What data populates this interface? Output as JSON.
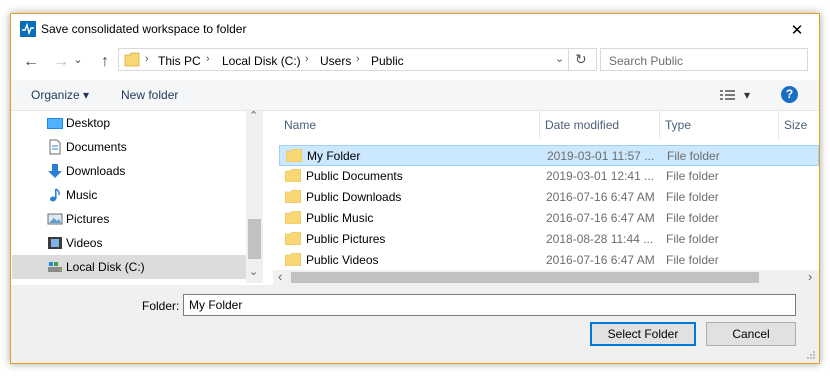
{
  "window": {
    "title": "Save consolidated workspace to folder",
    "close_glyph": "✕"
  },
  "nav_buttons": {
    "back": "←",
    "forward": "→",
    "dropdown": "⌄",
    "up": "↑"
  },
  "address": {
    "path": [
      "This PC",
      "Local Disk (C:)",
      "Users",
      "Public"
    ],
    "separator": "›",
    "dropdown": "⌄",
    "refresh": "↻"
  },
  "search": {
    "placeholder": "Search Public"
  },
  "toolbar": {
    "organize_label": "Organize",
    "organize_arrow": "▾",
    "new_folder_label": "New folder",
    "view_arrow": "▾",
    "help": "?"
  },
  "nav_pane": {
    "items": [
      {
        "label": "Desktop",
        "icon": "desktop-icon"
      },
      {
        "label": "Documents",
        "icon": "documents-icon"
      },
      {
        "label": "Downloads",
        "icon": "downloads-icon"
      },
      {
        "label": "Music",
        "icon": "music-icon"
      },
      {
        "label": "Pictures",
        "icon": "pictures-icon"
      },
      {
        "label": "Videos",
        "icon": "videos-icon"
      },
      {
        "label": "Local Disk (C:)",
        "icon": "drive-icon",
        "selected": true
      }
    ],
    "scroll_up": "⌃",
    "scroll_down": "⌄"
  },
  "file_list": {
    "columns": {
      "name": "Name",
      "date": "Date modified",
      "type": "Type",
      "size": "Size"
    },
    "sort_indicator": "⌃",
    "rows": [
      {
        "name": "My Folder",
        "date": "2019-03-01 11:57 ...",
        "type": "File folder",
        "selected": true
      },
      {
        "name": "Public Documents",
        "date": "2019-03-01 12:41 ...",
        "type": "File folder"
      },
      {
        "name": "Public Downloads",
        "date": "2016-07-16 6:47 AM",
        "type": "File folder"
      },
      {
        "name": "Public Music",
        "date": "2016-07-16 6:47 AM",
        "type": "File folder"
      },
      {
        "name": "Public Pictures",
        "date": "2018-08-28 11:44 ...",
        "type": "File folder"
      },
      {
        "name": "Public Videos",
        "date": "2016-07-16 6:47 AM",
        "type": "File folder"
      }
    ],
    "scroll_left": "‹",
    "scroll_right": "›"
  },
  "footer": {
    "folder_label": "Folder:",
    "folder_value": "My Folder",
    "select_label": "Select Folder",
    "cancel_label": "Cancel"
  },
  "colors": {
    "accent": "#0078d7",
    "selection": "#cce8ff",
    "folder": "#f8d775",
    "window_border": "#e3a21a"
  }
}
